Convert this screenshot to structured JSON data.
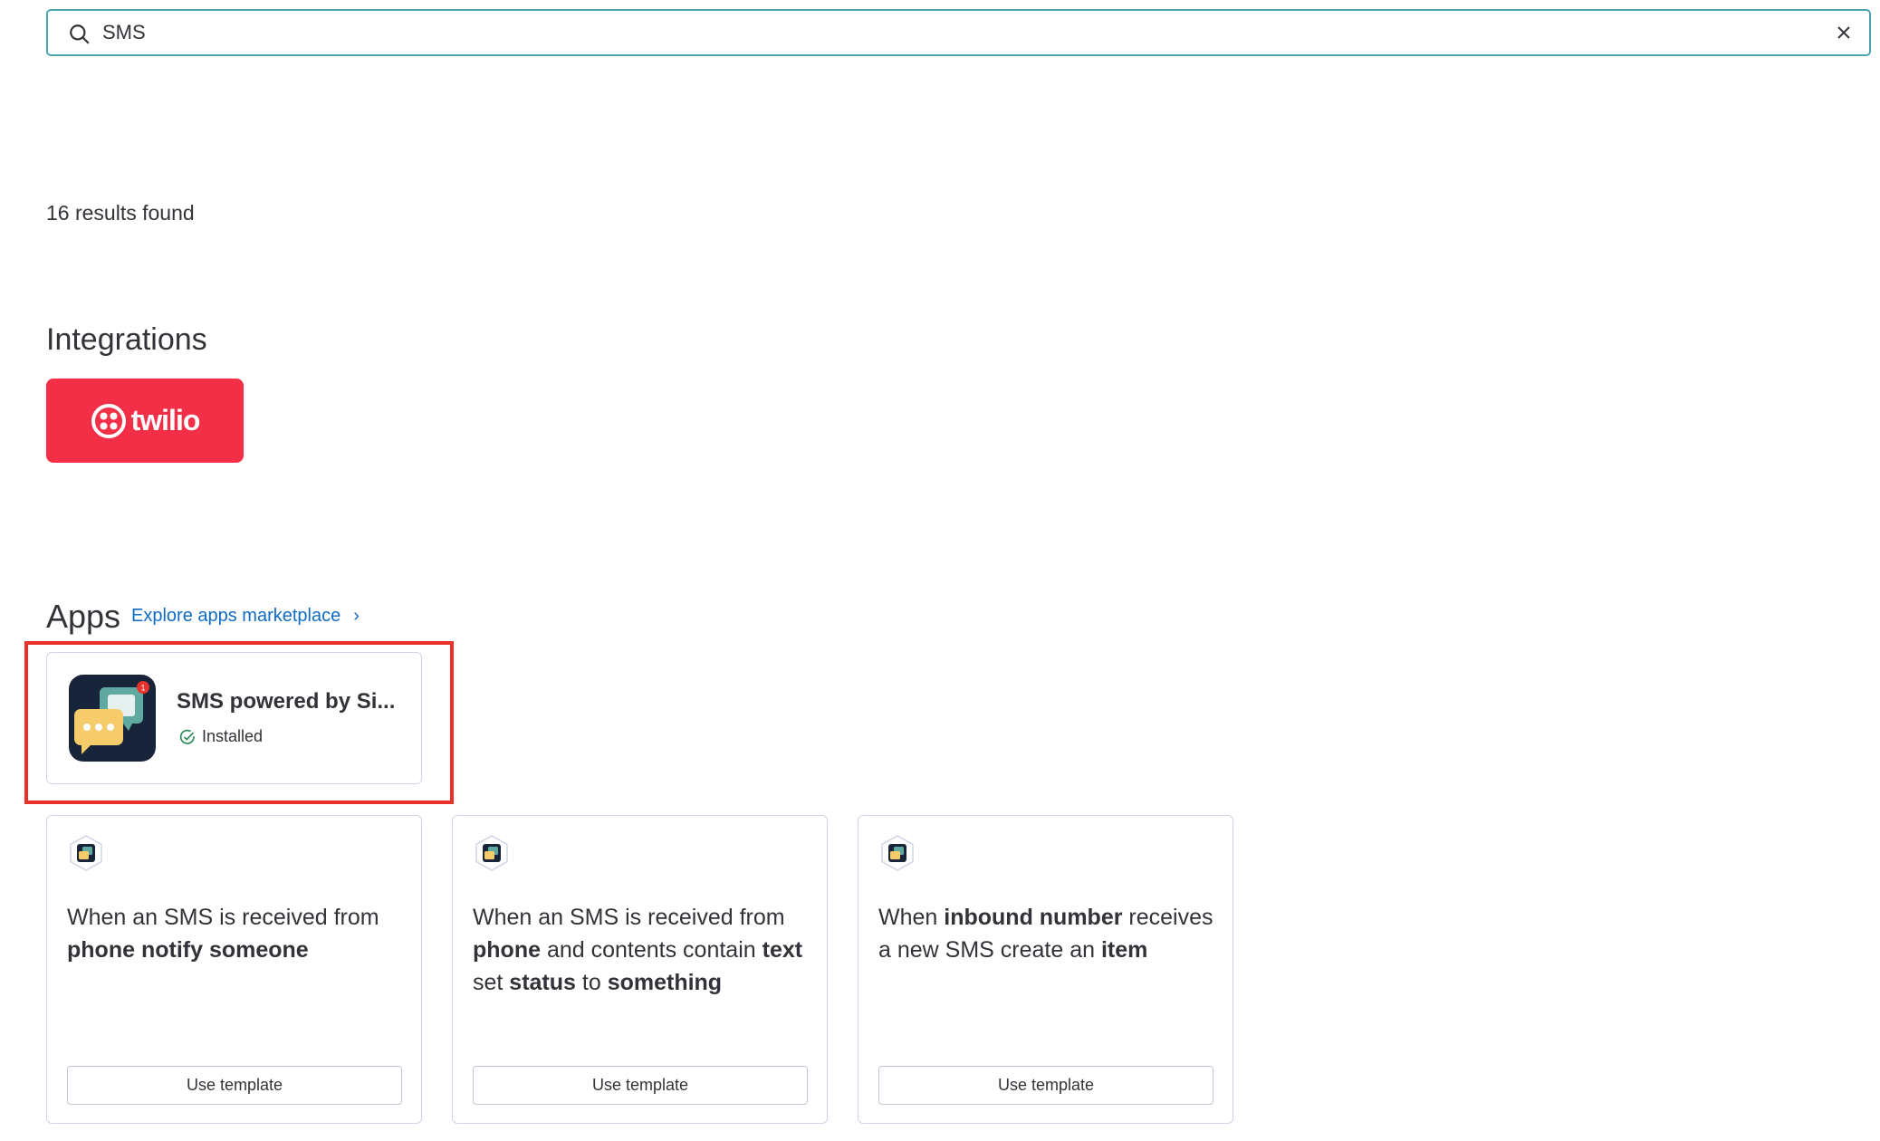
{
  "search": {
    "value": "SMS",
    "placeholder": ""
  },
  "results_text": "16 results found",
  "integrations": {
    "heading": "Integrations",
    "items": [
      {
        "name": "twilio",
        "brand_color": "#f22f46"
      }
    ]
  },
  "apps": {
    "heading": "Apps",
    "explore_link": "Explore apps marketplace",
    "explore_chevron": "›",
    "items": [
      {
        "name": "SMS powered by Si...",
        "status": "Installed",
        "badge_count": "1"
      }
    ]
  },
  "templates": [
    {
      "parts": [
        {
          "text": "When an SMS is received from ",
          "bold": false
        },
        {
          "text": "phone",
          "bold": true
        },
        {
          "text": " ",
          "bold": false
        },
        {
          "text": "notify",
          "bold": true
        },
        {
          "text": " ",
          "bold": false
        },
        {
          "text": "someone",
          "bold": true
        }
      ],
      "button": "Use template"
    },
    {
      "parts": [
        {
          "text": "When an SMS is received from ",
          "bold": false
        },
        {
          "text": "phone",
          "bold": true
        },
        {
          "text": " and contents contain ",
          "bold": false
        },
        {
          "text": "text",
          "bold": true
        },
        {
          "text": " set ",
          "bold": false
        },
        {
          "text": "status",
          "bold": true
        },
        {
          "text": " to ",
          "bold": false
        },
        {
          "text": "something",
          "bold": true
        }
      ],
      "button": "Use template"
    },
    {
      "parts": [
        {
          "text": "When ",
          "bold": false
        },
        {
          "text": "inbound number",
          "bold": true
        },
        {
          "text": " receives a new SMS create an ",
          "bold": false
        },
        {
          "text": "item",
          "bold": true
        }
      ],
      "button": "Use template"
    }
  ],
  "icons": {
    "search": "search-icon",
    "close": "close-icon",
    "installed": "check-circle-icon",
    "app": "chat-bubbles-icon"
  },
  "colors": {
    "accent_link": "#0f6bc4",
    "search_border": "#4ea4b3",
    "highlight": "#e8322b",
    "installed_check": "#258750"
  }
}
